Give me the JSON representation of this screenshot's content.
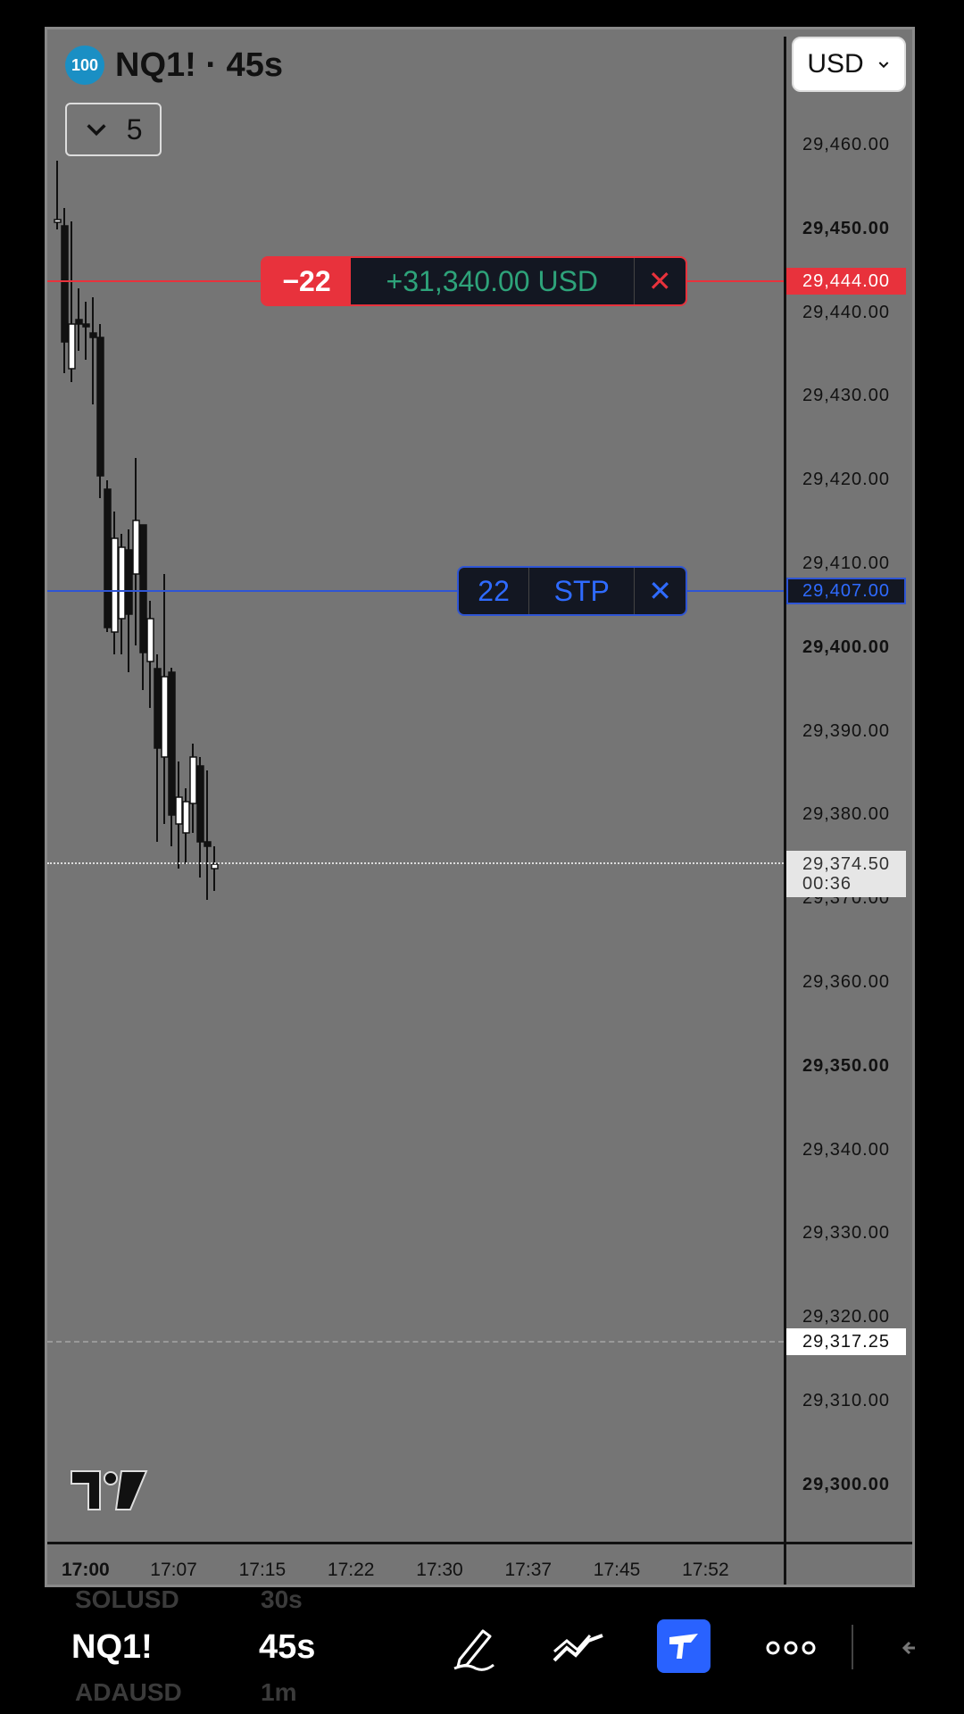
{
  "chart": {
    "badge": "100",
    "symbol_title": "NQ1! · 45s",
    "collapse_count": "5",
    "currency": "USD",
    "price_ticks": [
      {
        "label": "29,460.00",
        "bold": false
      },
      {
        "label": "29,450.00",
        "bold": true
      },
      {
        "label": "29,440.00",
        "bold": false
      },
      {
        "label": "29,430.00",
        "bold": false
      },
      {
        "label": "29,420.00",
        "bold": false
      },
      {
        "label": "29,410.00",
        "bold": false
      },
      {
        "label": "29,400.00",
        "bold": true
      },
      {
        "label": "29,390.00",
        "bold": false
      },
      {
        "label": "29,380.00",
        "bold": false
      },
      {
        "label": "29,370.00",
        "bold": false
      },
      {
        "label": "29,360.00",
        "bold": false
      },
      {
        "label": "29,350.00",
        "bold": true
      },
      {
        "label": "29,340.00",
        "bold": false
      },
      {
        "label": "29,330.00",
        "bold": false
      },
      {
        "label": "29,320.00",
        "bold": false
      },
      {
        "label": "29,310.00",
        "bold": false
      },
      {
        "label": "29,300.00",
        "bold": true
      }
    ],
    "time_ticks": [
      {
        "label": "17:00",
        "bold": true
      },
      {
        "label": "17:07",
        "bold": false
      },
      {
        "label": "17:15",
        "bold": false
      },
      {
        "label": "17:22",
        "bold": false
      },
      {
        "label": "17:30",
        "bold": false
      },
      {
        "label": "17:37",
        "bold": false
      },
      {
        "label": "17:45",
        "bold": false
      },
      {
        "label": "17:52",
        "bold": false
      }
    ],
    "position_order": {
      "qty": "−22",
      "pnl": "+31,340.00 USD",
      "price": "29,444.00",
      "color": "#e8323c"
    },
    "stop_order": {
      "qty": "22",
      "type": "STP",
      "price": "29,407.00",
      "color": "#2f55d4"
    },
    "last_price": {
      "price": "29,374.50",
      "countdown": "00:36"
    },
    "dashed_price": "29,317.25"
  },
  "bottom_bar": {
    "ghost_symbol_top": "SOLUSD",
    "ghost_interval_top": "30s",
    "symbol": "NQ1!",
    "interval": "45s",
    "ghost_symbol_bottom": "ADAUSD",
    "ghost_interval_bottom": "1m",
    "tools": [
      "pen-icon",
      "trend-icon",
      "trade-icon",
      "more-icon",
      "back-arrow-icon"
    ],
    "active_tool_color": "#2962ff"
  }
}
